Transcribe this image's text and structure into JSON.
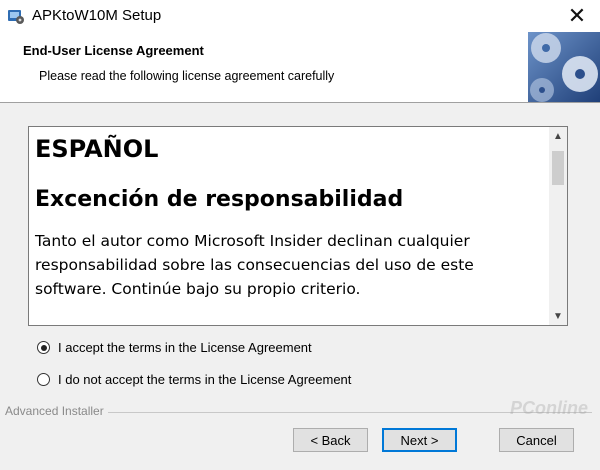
{
  "window": {
    "title": "APKtoW10M Setup",
    "close_symbol": "✕"
  },
  "header": {
    "title": "End-User License Agreement",
    "subtitle": "Please read the following license agreement carefully",
    "banner_icon": "cd-disc-banner"
  },
  "license": {
    "heading": "ESPAÑOL",
    "subheading": "Excención de responsabilidad",
    "body": "Tanto el autor como Microsoft Insider declinan cualquier responsabilidad sobre las consecuencias del uso de este software. Continúe bajo su propio criterio."
  },
  "options": {
    "accept": {
      "label": "I accept the terms in the License Agreement",
      "selected": true
    },
    "decline": {
      "label": "I do not accept the terms in the License Agreement",
      "selected": false
    }
  },
  "footer": {
    "brand": "Advanced Installer",
    "watermark": "PConline"
  },
  "buttons": {
    "back": "< Back",
    "next": "Next >",
    "cancel": "Cancel"
  },
  "colors": {
    "accent": "#0078d7",
    "banner": "#3f6aa8"
  }
}
